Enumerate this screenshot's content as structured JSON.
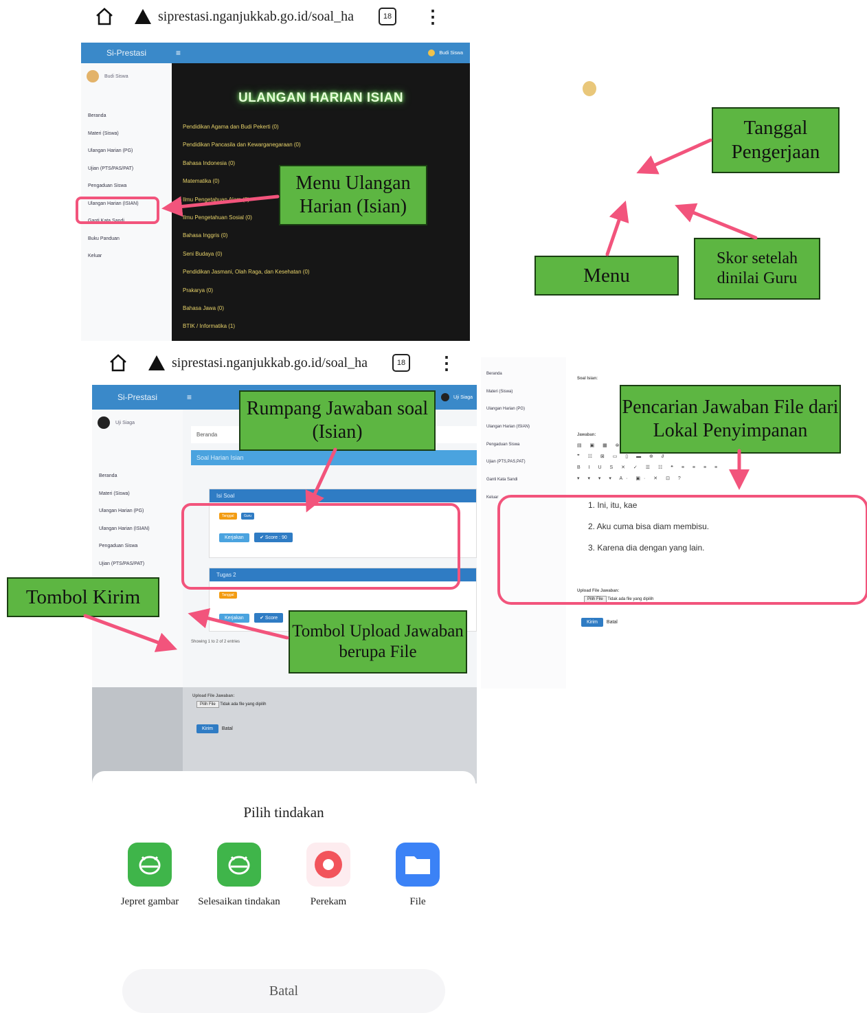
{
  "browser_top": {
    "url": "siprestasi.nganjukkab.go.id/soal_ha",
    "tabs_count": "18"
  },
  "browser_mid": {
    "url": "siprestasi.nganjukkab.go.id/soal_ha",
    "tabs_count": "18"
  },
  "app1": {
    "brand": "Si-Prestasi",
    "user": "Budi Siswa",
    "page_title": "ULANGAN HARIAN ISIAN",
    "menu": [
      "Beranda",
      "Materi (Siswa)",
      "Ulangan Harian (PG)",
      "Ujian (PTS/PAS/PAT)",
      "Pengaduan Siswa",
      "Ulangan Harian (ISIAN)",
      "Ganti Kata Sandi",
      "Buku Panduan",
      "Keluar"
    ],
    "subjects": [
      "Pendidikan Agama dan Budi Pekerti (0)",
      "Pendidikan Pancasila dan Kewarganegaraan (0)",
      "Bahasa Indonesia (0)",
      "Matematika (0)",
      "Ilmu Pengetahuan Alam (0)",
      "Ilmu Pengetahuan Sosial (0)",
      "Bahasa Inggris (0)",
      "Seni Budaya (0)",
      "Pendidikan Jasmani, Olah Raga, dan Kesehatan (0)",
      "Prakarya (0)",
      "Bahasa Jawa (0)",
      "BTIK / Informatika (1)"
    ]
  },
  "app2": {
    "brand": "Si-Prestasi",
    "user": "Uji Siaga",
    "menu": [
      "Beranda",
      "Materi (Siswa)",
      "Ulangan Harian (PG)",
      "Ulangan Harian (ISIAN)",
      "Pengaduan Siswa",
      "Ujian (PTS/PAS/PAT)"
    ],
    "crumb": "Beranda",
    "section": "Soal Harian Isian",
    "card1": {
      "number": "1",
      "header": "Isi Soal",
      "tag_date": "Tanggal",
      "tag_teacher": "Guru",
      "btn_answer": "Kerjakan",
      "btn_score": "✔ Score : 90"
    },
    "card2": {
      "number": "2",
      "header": "Tugas 2",
      "btn_score": "✔ Score"
    },
    "footer": "Showing 1 to 2 of 2 entries"
  },
  "upload_panel": {
    "label": "Upload File Jawaban:",
    "choose": "Pilih File",
    "no_file": "Tidak ada file yang dipilih",
    "submit": "Kirim",
    "back": "Batal"
  },
  "sheet": {
    "title": "Pilih tindakan",
    "actions": [
      {
        "label": "Jepret gambar",
        "icon": "camera-icon"
      },
      {
        "label": "Selesaikan tindakan",
        "icon": "android-icon"
      },
      {
        "label": "Perekam",
        "icon": "record-icon"
      },
      {
        "label": "File",
        "icon": "folder-icon"
      }
    ],
    "cancel": "Batal"
  },
  "editor": {
    "menu": [
      "Beranda",
      "Materi (Siswa)",
      "Ulangan Harian (PG)",
      "Ulangan Harian (ISIAN)",
      "Pengaduan Siswa",
      "Ujian (PTS,PAS,PAT)",
      "Ganti Kata Sandi",
      "Keluar"
    ],
    "soal_label": "Soal Isian:",
    "answer_label": "Jawaban:",
    "answers": [
      "1. Ini, itu, kae",
      "2. Aku cuma bisa diam membisu.",
      "3. Karena dia dengan yang lain."
    ],
    "upload_label": "Upload File Jawaban:",
    "choose": "Pilih File",
    "no_file": "Tidak ada file yang dipilih",
    "submit": "Kirim",
    "back": "Batal"
  },
  "annotations": {
    "menu_ulangan": "Menu Ulangan Harian (Isian)",
    "tanggal": "Tanggal Pengerjaan",
    "menu": "Menu",
    "skor": "Skor setelah dinilai Guru",
    "rumpang": "Rumpang Jawaban soal (Isian)",
    "pencarian": "Pencarian Jawaban File dari Lokal Penyimpanan",
    "tombol_kirim": "Tombol Kirim",
    "tombol_upload": "Tombol Upload Jawaban berupa File"
  },
  "colors": {
    "annotation_green": "#5db642",
    "highlight_pink": "#f2547c",
    "topbar_blue": "#3a89c9",
    "file_blue": "#3b82f6",
    "record_red": "#f2545b"
  }
}
